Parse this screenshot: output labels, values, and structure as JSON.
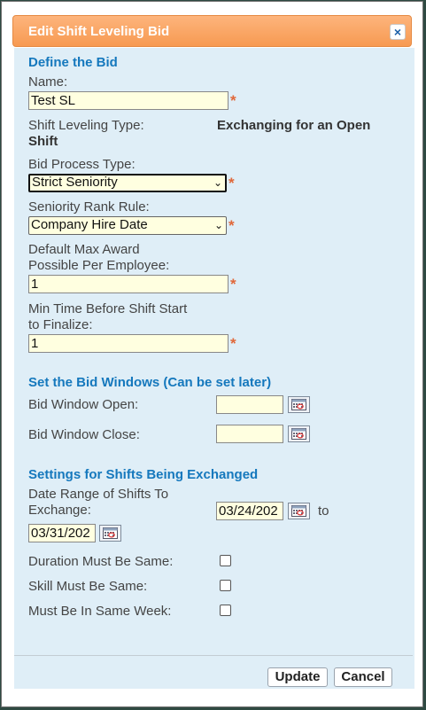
{
  "dialog": {
    "title": "Edit Shift Leveling Bid",
    "close_icon": "×"
  },
  "define_bid": {
    "heading": "Define the Bid",
    "name_label": "Name:",
    "name_value": "Test SL",
    "type_label": "Shift Leveling Type:",
    "type_value_line1": "Exchanging for an Open",
    "type_value_line2": "Shift",
    "process_label": "Bid Process Type:",
    "process_value": "Strict Seniority",
    "rank_label": "Seniority Rank Rule:",
    "rank_value": "Company Hire Date",
    "max_award_label_line1": "Default Max Award",
    "max_award_label_line2": "Possible Per Employee:",
    "max_award_value": "1",
    "min_time_label_line1": "Min Time Before Shift Start",
    "min_time_label_line2": "to Finalize:",
    "min_time_value": "1",
    "required_marker": "*"
  },
  "bid_windows": {
    "heading": "Set the Bid Windows (Can be set later)",
    "open_label": "Bid Window Open:",
    "open_value": "",
    "close_label": "Bid Window Close:",
    "close_value": ""
  },
  "exchange": {
    "heading": "Settings for Shifts Being Exchanged",
    "range_label_line1": "Date Range of Shifts To",
    "range_label_line2": "Exchange:",
    "range_start": "03/24/202",
    "to_label": "to",
    "range_end": "03/31/202",
    "duration_label": "Duration Must Be Same:",
    "skill_label": "Skill Must Be Same:",
    "week_label": "Must Be In Same Week:",
    "duration_checked": false,
    "skill_checked": false,
    "week_checked": false
  },
  "footer": {
    "update_label": "Update",
    "cancel_label": "Cancel"
  },
  "colors": {
    "accent": "#1578bd",
    "title_bar": "#f79a52",
    "field_bg": "#ffffe0",
    "panel_bg": "#dfeef7"
  }
}
